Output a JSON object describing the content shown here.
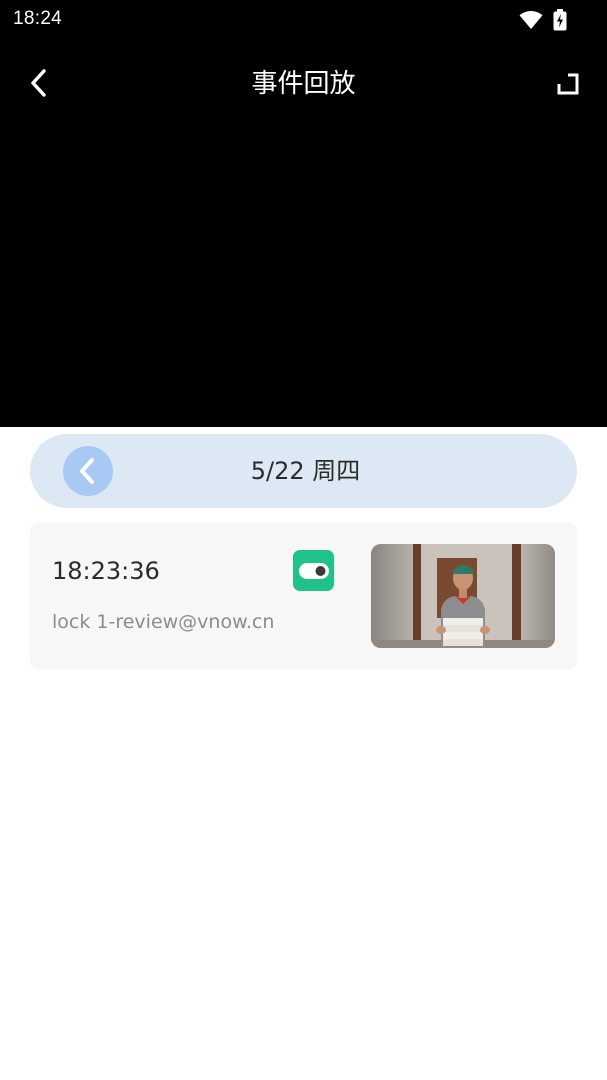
{
  "status_bar": {
    "time": "18:24",
    "icons": [
      "wifi-icon",
      "battery-charging-icon"
    ]
  },
  "header": {
    "title": "事件回放",
    "back_icon": "chevron-left-icon",
    "fullscreen_icon": "fullscreen-toggle-icon"
  },
  "date_bar": {
    "label": "5/22 周四",
    "back_icon": "chevron-left-icon"
  },
  "events": [
    {
      "time": "18:23:36",
      "user": "lock 1-review@vnow.cn",
      "event_icon": "lock-toggle-icon",
      "thumbnail": "delivery-person-thumbnail"
    }
  ],
  "colors": {
    "video_bg": "#000000",
    "date_bar_bg": "#dce9f5",
    "date_back_bg": "#a9c9f5",
    "event_icon_bg": "#1fc38a",
    "card_bg": "#f7f7f7"
  }
}
